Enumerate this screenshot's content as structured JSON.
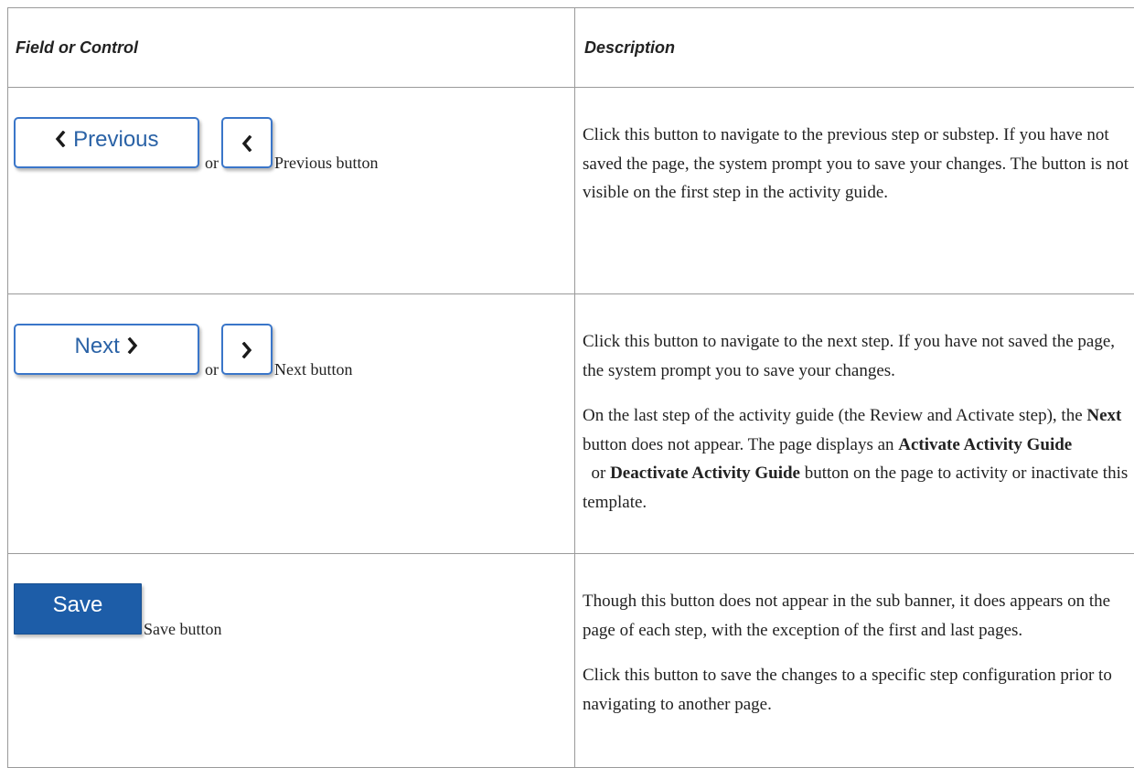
{
  "table": {
    "header_field": "Field or Control",
    "header_description": "Description"
  },
  "previous": {
    "button_text": "Previous",
    "or_text": "or",
    "label": "Previous button",
    "description": "Click this button to navigate to the previous step or substep. If you have not saved the page, the system prompt you to save your changes. The button is not visible on the first step in the activity guide."
  },
  "next": {
    "button_text": "Next",
    "or_text": "or",
    "label": "Next button",
    "description_1": "Click this button to navigate to the next step. If you have not saved the page, the system prompt you to save your changes.",
    "description_2": {
      "t1": "On the last step of the activity guide (the Review and Activate step), the ",
      "b1": "Next",
      "t2": " button does not appear. The page displays an ",
      "b2": "Activate Activity Guide",
      "t3": "  or ",
      "b3": "Deactivate Activity Guide",
      "t4": " button on the page to activity or inactivate this template."
    }
  },
  "save": {
    "button_text": "Save",
    "label": "Save button",
    "description_1": "Though this button does not appear in the sub banner, it does appears on the page of each step, with the exception of the first and last pages.",
    "description_2": "Click this button to save the changes to a specific step configuration prior to navigating to another page."
  },
  "colors": {
    "outline_border": "#3a76c9",
    "outline_text": "#2a62a6",
    "save_fill": "#1d5da8",
    "table_border": "#9a9a9a"
  },
  "icons": [
    "chevron-left-icon",
    "chevron-right-icon"
  ]
}
